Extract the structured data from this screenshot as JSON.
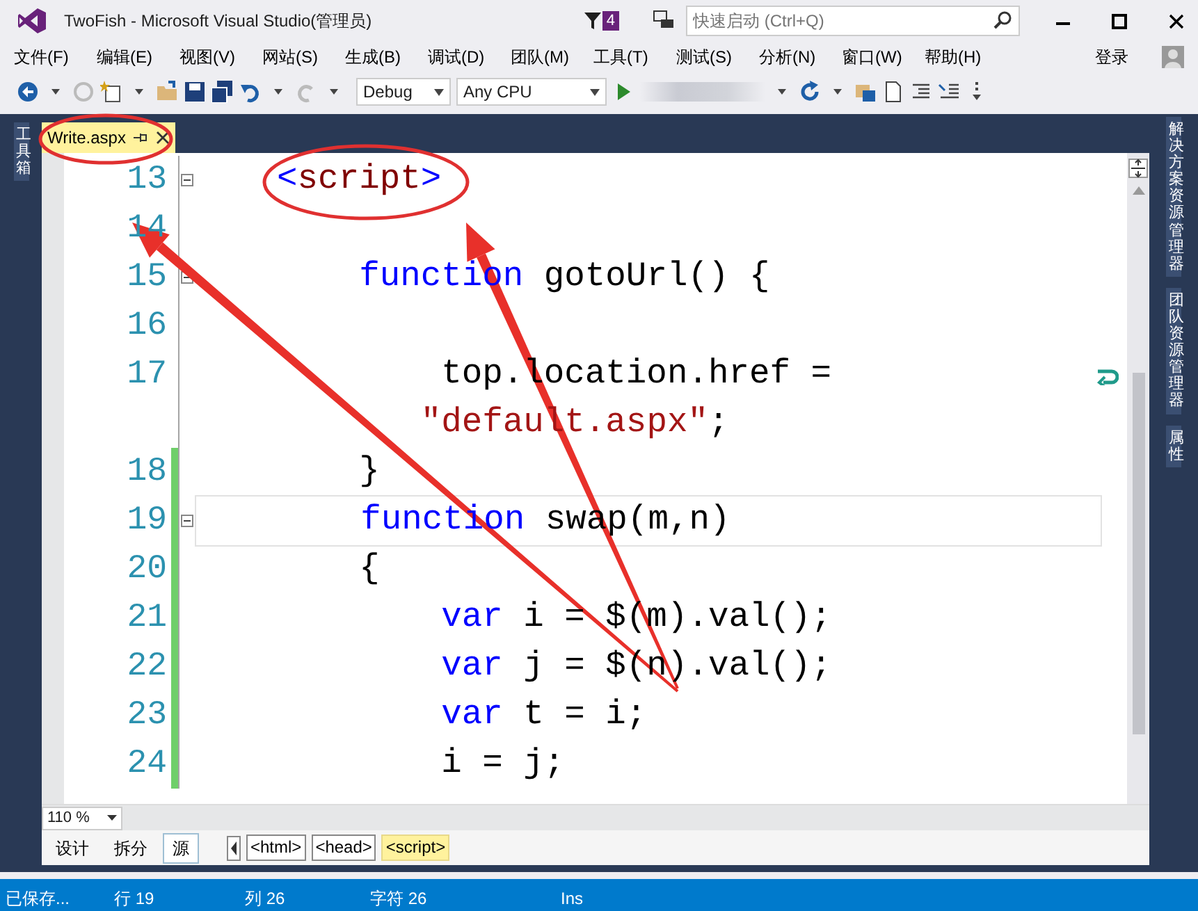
{
  "window": {
    "title": "TwoFish - Microsoft Visual Studio(管理员)",
    "notification_count": "4",
    "quick_launch": {
      "placeholder": "快速启动 (Ctrl+Q)"
    }
  },
  "menu": [
    "文件(F)",
    "编辑(E)",
    "视图(V)",
    "网站(S)",
    "生成(B)",
    "调试(D)",
    "团队(M)",
    "工具(T)",
    "测试(S)",
    "分析(N)",
    "窗口(W)",
    "帮助(H)"
  ],
  "account": "登录",
  "toolbar": {
    "configuration": "Debug",
    "platform": "Any CPU"
  },
  "left_panels": [
    {
      "label": "工具箱"
    }
  ],
  "right_panels": [
    {
      "label": "解决方案资源管理器"
    },
    {
      "label": "团队资源管理器"
    },
    {
      "label": "属性"
    }
  ],
  "document_tabs": [
    {
      "title": "Write.aspx",
      "selected": true
    }
  ],
  "editor": {
    "lines": [
      {
        "number": "13",
        "foldable": true,
        "changed": false,
        "current": false,
        "tokens": [
          {
            "kind": "delim",
            "text": "    <"
          },
          {
            "kind": "tag",
            "text": "script"
          },
          {
            "kind": "delim",
            "text": ">"
          }
        ]
      },
      {
        "number": "14",
        "foldable": false,
        "changed": false,
        "current": false
      },
      {
        "number": "15",
        "foldable": true,
        "changed": false,
        "current": false,
        "tokens": [
          {
            "kind": "keyword",
            "text": "        function"
          },
          {
            "kind": "plain",
            "text": " gotoUrl() {"
          }
        ]
      },
      {
        "number": "16",
        "foldable": false,
        "changed": false,
        "current": false
      },
      {
        "number": "17",
        "foldable": false,
        "changed": false,
        "current": false,
        "tokens": [
          {
            "kind": "plain",
            "text": "            top.location.href ="
          }
        ],
        "continuation": [
          {
            "kind": "string",
            "text": "           \"default.aspx\""
          },
          {
            "kind": "plain",
            "text": ";"
          }
        ]
      },
      {
        "number": "18",
        "foldable": false,
        "changed": true,
        "current": false,
        "tokens": [
          {
            "kind": "plain",
            "text": "        }"
          }
        ]
      },
      {
        "number": "19",
        "foldable": true,
        "changed": true,
        "current": true,
        "tokens": [
          {
            "kind": "keyword",
            "text": "        function"
          },
          {
            "kind": "plain",
            "text": " swap(m,n)"
          }
        ]
      },
      {
        "number": "20",
        "foldable": false,
        "changed": true,
        "current": false,
        "tokens": [
          {
            "kind": "plain",
            "text": "        {"
          }
        ]
      },
      {
        "number": "21",
        "foldable": false,
        "changed": true,
        "current": false,
        "tokens": [
          {
            "kind": "keyword",
            "text": "            var"
          },
          {
            "kind": "plain",
            "text": " i = $(m).val();"
          }
        ]
      },
      {
        "number": "22",
        "foldable": false,
        "changed": true,
        "current": false,
        "tokens": [
          {
            "kind": "keyword",
            "text": "            var"
          },
          {
            "kind": "plain",
            "text": " j = $(n).val();"
          }
        ]
      },
      {
        "number": "23",
        "foldable": false,
        "changed": true,
        "current": false,
        "tokens": [
          {
            "kind": "keyword",
            "text": "            var"
          },
          {
            "kind": "plain",
            "text": " t = i;"
          }
        ]
      },
      {
        "number": "24",
        "foldable": false,
        "changed": true,
        "current": false,
        "tokens": [
          {
            "kind": "plain",
            "text": "            i = j;"
          }
        ]
      }
    ]
  },
  "zoom": "110 %",
  "view_tabs": [
    {
      "label": "设计",
      "selected": false
    },
    {
      "label": "拆分",
      "selected": false
    },
    {
      "label": "源",
      "selected": true
    }
  ],
  "breadcrumbs": [
    {
      "label": "<html>",
      "selected": false
    },
    {
      "label": "<head>",
      "selected": false
    },
    {
      "label": "<script>",
      "selected": true
    }
  ],
  "status_bar": [
    "已保存...",
    "行 19",
    "列 26",
    "字符 26",
    "Ins"
  ]
}
